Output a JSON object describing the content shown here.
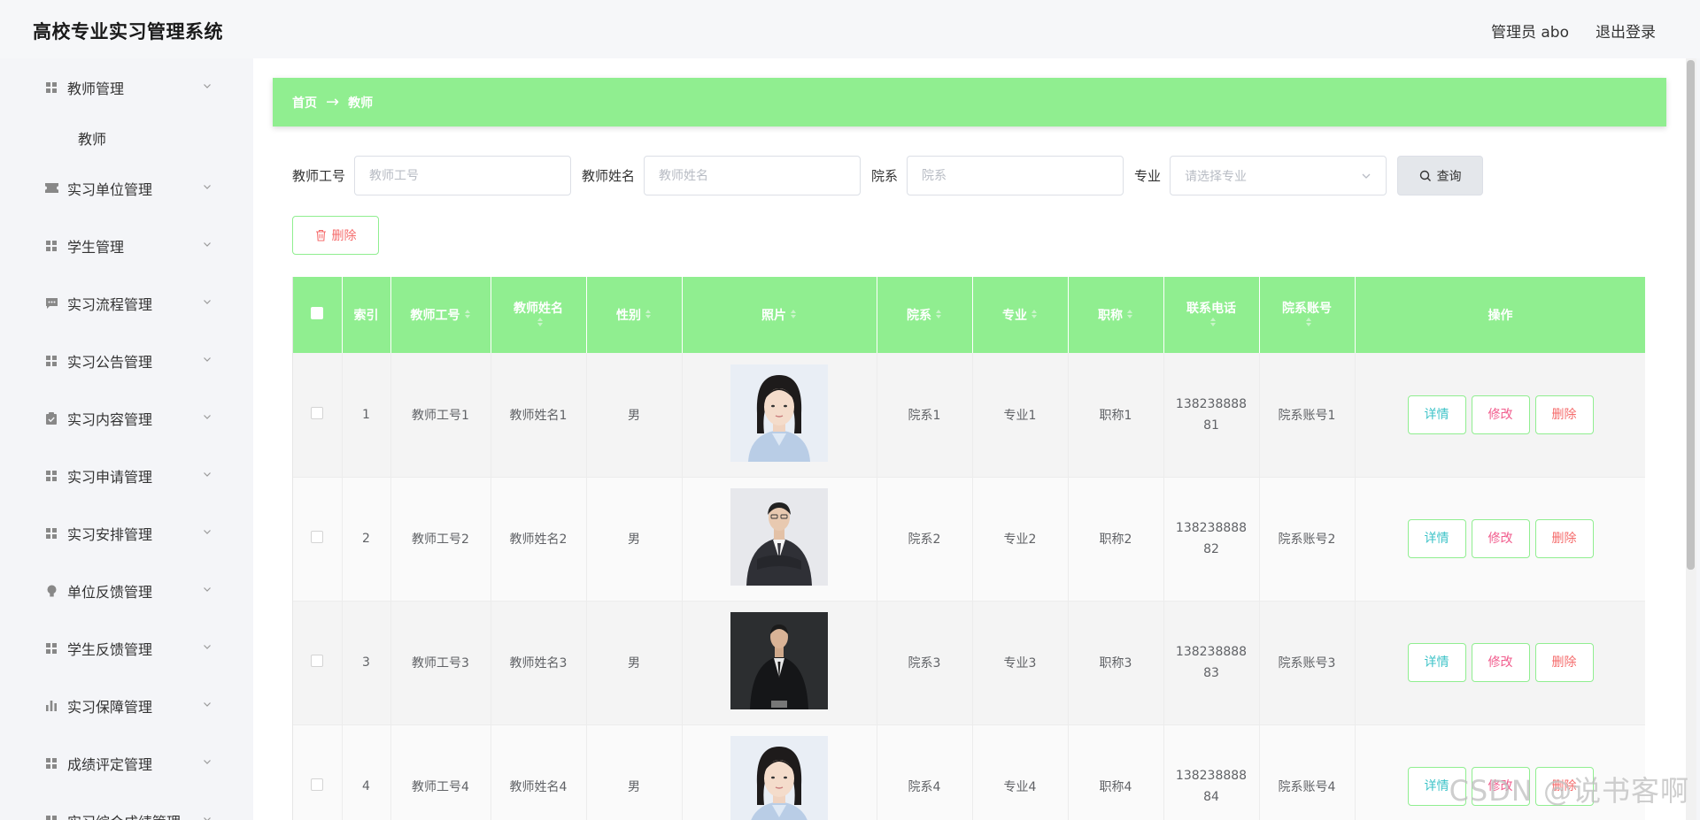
{
  "app": {
    "title": "高校专业实习管理系统"
  },
  "header": {
    "admin": "管理员 abo",
    "logout": "退出登录"
  },
  "sidebar": {
    "items": [
      {
        "label": "教师管理",
        "icon": "grid-icon"
      },
      {
        "label": "实习单位管理",
        "icon": "ticket-icon"
      },
      {
        "label": "学生管理",
        "icon": "grid-icon"
      },
      {
        "label": "实习流程管理",
        "icon": "chat-icon"
      },
      {
        "label": "实习公告管理",
        "icon": "grid-icon"
      },
      {
        "label": "实习内容管理",
        "icon": "clipboard-icon"
      },
      {
        "label": "实习申请管理",
        "icon": "grid-icon"
      },
      {
        "label": "实习安排管理",
        "icon": "grid-icon"
      },
      {
        "label": "单位反馈管理",
        "icon": "bulb-icon"
      },
      {
        "label": "学生反馈管理",
        "icon": "grid-icon"
      },
      {
        "label": "实习保障管理",
        "icon": "bar-chart-icon"
      },
      {
        "label": "成绩评定管理",
        "icon": "grid-icon"
      },
      {
        "label": "实习综合成绩管理",
        "icon": "grid-icon"
      }
    ],
    "submenu": {
      "label": "教师"
    }
  },
  "breadcrumb": {
    "home": "首页",
    "arrow": "→",
    "current": "教师"
  },
  "search": {
    "teacher_id_label": "教师工号",
    "teacher_id_placeholder": "教师工号",
    "teacher_name_label": "教师姓名",
    "teacher_name_placeholder": "教师姓名",
    "dept_label": "院系",
    "dept_placeholder": "院系",
    "major_label": "专业",
    "major_placeholder": "请选择专业",
    "query_button": "查询"
  },
  "actions": {
    "delete": "删除"
  },
  "table": {
    "headers": [
      "索引",
      "教师工号",
      "教师姓名",
      "性别",
      "照片",
      "院系",
      "专业",
      "职称",
      "联系电话",
      "院系账号",
      "操作"
    ],
    "rows": [
      {
        "index": "1",
        "teacher_id": "教师工号1",
        "teacher_name": "教师姓名1",
        "gender": "男",
        "photo": "female-portrait",
        "dept": "院系1",
        "major": "专业1",
        "title": "职称1",
        "phone_a": "138238888",
        "phone_b": "81",
        "dept_account": "院系账号1"
      },
      {
        "index": "2",
        "teacher_id": "教师工号2",
        "teacher_name": "教师姓名2",
        "gender": "男",
        "photo": "male-portrait-light",
        "dept": "院系2",
        "major": "专业2",
        "title": "职称2",
        "phone_a": "138238888",
        "phone_b": "82",
        "dept_account": "院系账号2"
      },
      {
        "index": "3",
        "teacher_id": "教师工号3",
        "teacher_name": "教师姓名3",
        "gender": "男",
        "photo": "male-portrait-dark",
        "dept": "院系3",
        "major": "专业3",
        "title": "职称3",
        "phone_a": "138238888",
        "phone_b": "83",
        "dept_account": "院系账号3"
      },
      {
        "index": "4",
        "teacher_id": "教师工号4",
        "teacher_name": "教师姓名4",
        "gender": "男",
        "photo": "female-portrait",
        "dept": "院系4",
        "major": "专业4",
        "title": "职称4",
        "phone_a": "138238888",
        "phone_b": "84",
        "dept_account": "院系账号4"
      }
    ],
    "ops": {
      "detail": "详情",
      "edit": "修改",
      "delete": "删除"
    }
  },
  "watermark": "CSDN @说书客啊",
  "colors": {
    "accent": "#90ee90",
    "detail": "#3ec3c8",
    "edit": "#f15b8c",
    "delete": "#f56c6c"
  }
}
